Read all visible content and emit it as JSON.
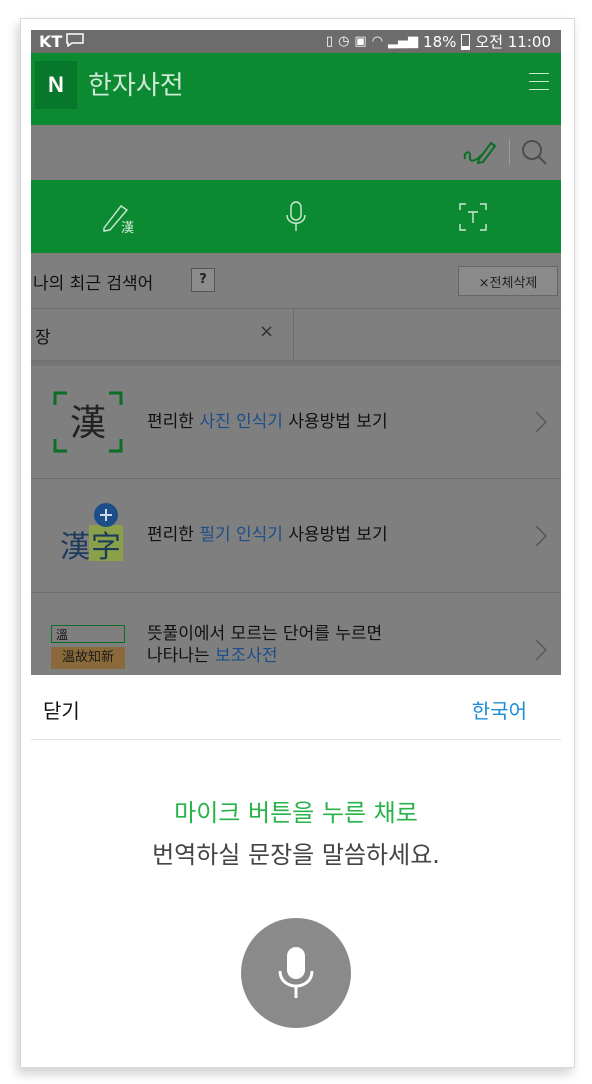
{
  "status_bar": {
    "carrier": "KT",
    "battery": "18%",
    "time": "오전 11:00"
  },
  "app_bar": {
    "logo": "N",
    "title": "한자사전"
  },
  "recent": {
    "title": "나의 최근 검색어",
    "help": "?",
    "delete_all": "×전체삭제",
    "items": [
      {
        "word": "장",
        "remove": "×"
      }
    ]
  },
  "guides": [
    {
      "icon_text": "漢",
      "before": "편리한 ",
      "highlight": "사진 인식기",
      "after": " 사용방법 보기"
    },
    {
      "icon_text": "漢字",
      "before": "편리한 ",
      "highlight": "필기 인식기",
      "after": " 사용방법 보기"
    },
    {
      "icon_top": "溫",
      "icon_bottom": "溫故知新",
      "line1": "뜻풀이에서 모르는 단어를 누르면",
      "before": "나타나는 ",
      "highlight": "보조사전"
    }
  ],
  "voice_sheet": {
    "close": "닫기",
    "language": "한국어",
    "prompt_line1": "마이크 버튼을 누른 채로",
    "prompt_line2": "번역하실 문장을 말씀하세요."
  },
  "colors": {
    "brand_green": "#0b8a31",
    "prompt_green": "#27b34a",
    "link_blue": "#1a8fd6",
    "dim_overlay": "#7f7f7f"
  }
}
